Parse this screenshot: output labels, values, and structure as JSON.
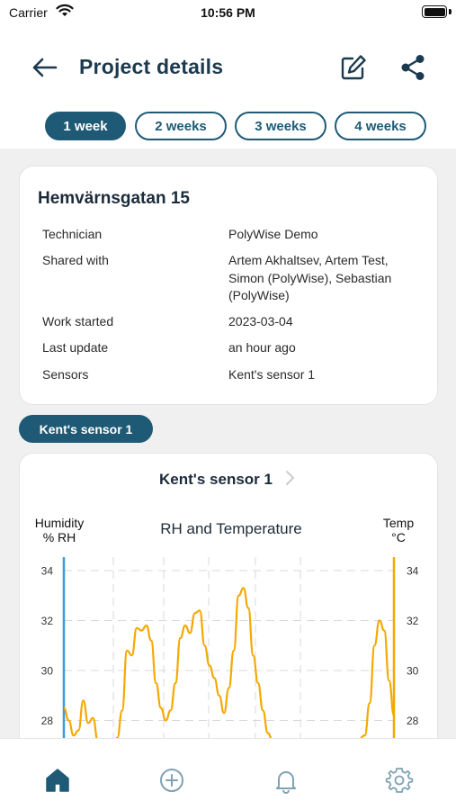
{
  "status_bar": {
    "carrier": "Carrier",
    "time": "10:56 PM"
  },
  "header": {
    "title": "Project details"
  },
  "tabs": [
    {
      "label": "1 week",
      "active": true
    },
    {
      "label": "2 weeks",
      "active": false
    },
    {
      "label": "3 weeks",
      "active": false
    },
    {
      "label": "4 weeks",
      "active": false
    }
  ],
  "project": {
    "name": "Hemvärnsgatan 15",
    "rows": [
      {
        "label": "Technician",
        "value": "PolyWise Demo"
      },
      {
        "label": "Shared with",
        "value": "Artem Akhaltsev, Artem Test, Simon (PolyWise), Sebastian (PolyWise)"
      },
      {
        "label": "Work started",
        "value": "2023-03-04"
      },
      {
        "label": "Last update",
        "value": "an hour ago"
      },
      {
        "label": "Sensors",
        "value": "Kent's sensor 1"
      }
    ]
  },
  "sensor_pill": "Kent's sensor 1",
  "chart_card": {
    "sensor_title": "Kent's sensor 1",
    "left_axis_title": "Humidity\n% RH",
    "right_axis_title": "Temp\n°C",
    "chart_title": "RH and Temperature"
  },
  "colors": {
    "primary": "#1e5a76",
    "humidity_axis": "#3a9ad9",
    "temperature_line": "#f5a800"
  },
  "icons": {
    "back": "arrow-left-icon",
    "edit": "pencil-edit-icon",
    "share": "share-icon",
    "home": "home-icon",
    "add": "plus-circle-icon",
    "notifications": "bell-icon",
    "settings": "gear-icon"
  },
  "chart_data": {
    "type": "line",
    "title": "RH and Temperature",
    "ylabel": "Humidity % RH",
    "y2label": "Temp °C",
    "y_ticks": [
      "34",
      "32",
      "30",
      "28"
    ],
    "y2_ticks": [
      "34",
      "32",
      "30",
      "28"
    ],
    "ylim_visible": [
      27.5,
      34.5
    ],
    "grid": true,
    "series": [
      {
        "axis": "right",
        "values": [
          [
            0.0,
            28.5
          ],
          [
            0.5,
            28.0
          ],
          [
            1.0,
            27.4
          ],
          [
            1.5,
            27.6
          ],
          [
            2.0,
            28.8
          ],
          [
            2.5,
            27.9
          ],
          [
            3.0,
            28.1
          ],
          [
            3.5,
            27.2
          ],
          [
            4.0,
            27.0
          ],
          [
            4.5,
            26.8
          ],
          [
            5.0,
            27.0
          ],
          [
            5.5,
            27.3
          ],
          [
            6.0,
            28.4
          ],
          [
            6.5,
            30.8
          ],
          [
            7.0,
            30.6
          ],
          [
            7.5,
            31.7
          ],
          [
            8.0,
            31.6
          ],
          [
            8.5,
            31.8
          ],
          [
            9.0,
            31.2
          ],
          [
            9.5,
            29.5
          ],
          [
            10.0,
            28.5
          ],
          [
            10.5,
            28.0
          ],
          [
            11.0,
            28.4
          ],
          [
            11.5,
            29.5
          ],
          [
            12.0,
            31.3
          ],
          [
            12.5,
            31.8
          ],
          [
            13.0,
            31.5
          ],
          [
            13.5,
            32.3
          ],
          [
            14.0,
            32.4
          ],
          [
            14.5,
            31.0
          ],
          [
            15.0,
            30.2
          ],
          [
            15.5,
            29.7
          ],
          [
            16.0,
            29.0
          ],
          [
            16.5,
            28.3
          ],
          [
            17.0,
            29.3
          ],
          [
            17.5,
            30.8
          ],
          [
            18.0,
            33.0
          ],
          [
            18.5,
            33.3
          ],
          [
            19.0,
            32.5
          ],
          [
            19.5,
            30.6
          ],
          [
            20.0,
            29.5
          ],
          [
            20.5,
            28.4
          ],
          [
            21.0,
            27.5
          ],
          [
            21.5,
            27.2
          ],
          [
            22.0,
            27.0
          ],
          [
            30.0,
            27.0
          ],
          [
            31.0,
            27.4
          ],
          [
            31.5,
            28.7
          ],
          [
            32.0,
            31.0
          ],
          [
            32.5,
            32.0
          ],
          [
            33.0,
            31.6
          ],
          [
            33.5,
            29.6
          ],
          [
            34.0,
            28.2
          ]
        ]
      }
    ]
  }
}
